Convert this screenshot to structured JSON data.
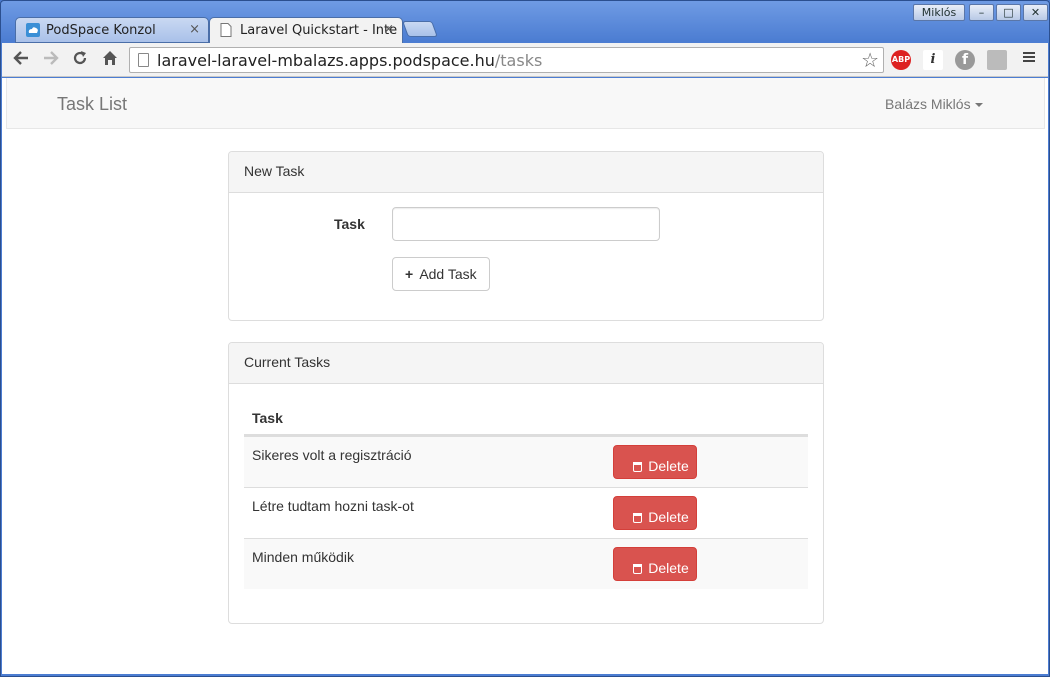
{
  "browser": {
    "user": "Miklós",
    "window_controls": [
      "–",
      "□",
      "✕"
    ],
    "tabs": [
      {
        "title": "PodSpace Konzol",
        "close": "×"
      },
      {
        "title": "Laravel Quickstart - Inte",
        "close": "×"
      }
    ],
    "url_host": "laravel-laravel-mbalazs.apps.podspace.hu",
    "url_path": "/tasks",
    "star": "☆",
    "extensions": {
      "abp": "ABP",
      "info": "i",
      "fedora": "f"
    }
  },
  "nav": {
    "brand": "Task List",
    "user": "Balázs Miklós"
  },
  "new_task": {
    "heading": "New Task",
    "label": "Task",
    "input_value": "",
    "button_icon": "+",
    "button_label": "Add Task"
  },
  "current_tasks": {
    "heading": "Current Tasks",
    "column": "Task",
    "delete_label": "Delete",
    "rows": [
      {
        "name": "Sikeres volt a regisztráció"
      },
      {
        "name": "Létre tudtam hozni task-ot"
      },
      {
        "name": "Minden működik"
      }
    ]
  },
  "colors": {
    "danger": "#d9534f",
    "chrome_blue": "#4c7dd2"
  }
}
